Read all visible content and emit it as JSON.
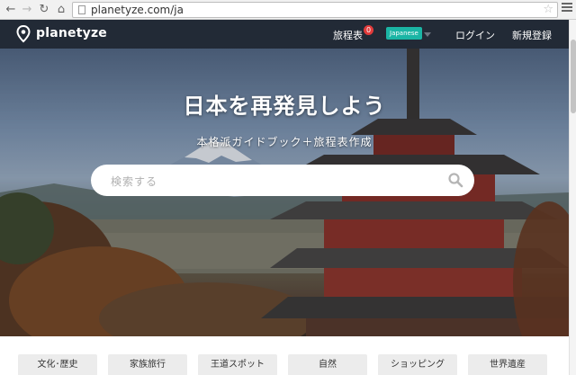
{
  "browser": {
    "url": "planetyze.com/ja",
    "icons": [
      "back-arrow-icon",
      "forward-arrow-icon",
      "reload-icon",
      "home-icon",
      "page-icon",
      "star-icon",
      "menu-icon"
    ]
  },
  "header": {
    "logo_text": "planetyze",
    "itinerary_label": "旅程表",
    "itinerary_count": "0",
    "language": "Japanese",
    "login_label": "ログイン",
    "signup_label": "新規登録"
  },
  "hero": {
    "title": "日本を再発見しよう",
    "subtitle": "本格派ガイドブック＋旅程表作成",
    "search_placeholder": "検索する"
  },
  "categories": [
    "文化･歴史",
    "家族旅行",
    "王道スポット",
    "自然",
    "ショッピング",
    "世界遺産"
  ],
  "colors": {
    "header_bg": "#222a36",
    "language_badge": "#1bb5a5",
    "count_badge": "#e23b3b"
  }
}
